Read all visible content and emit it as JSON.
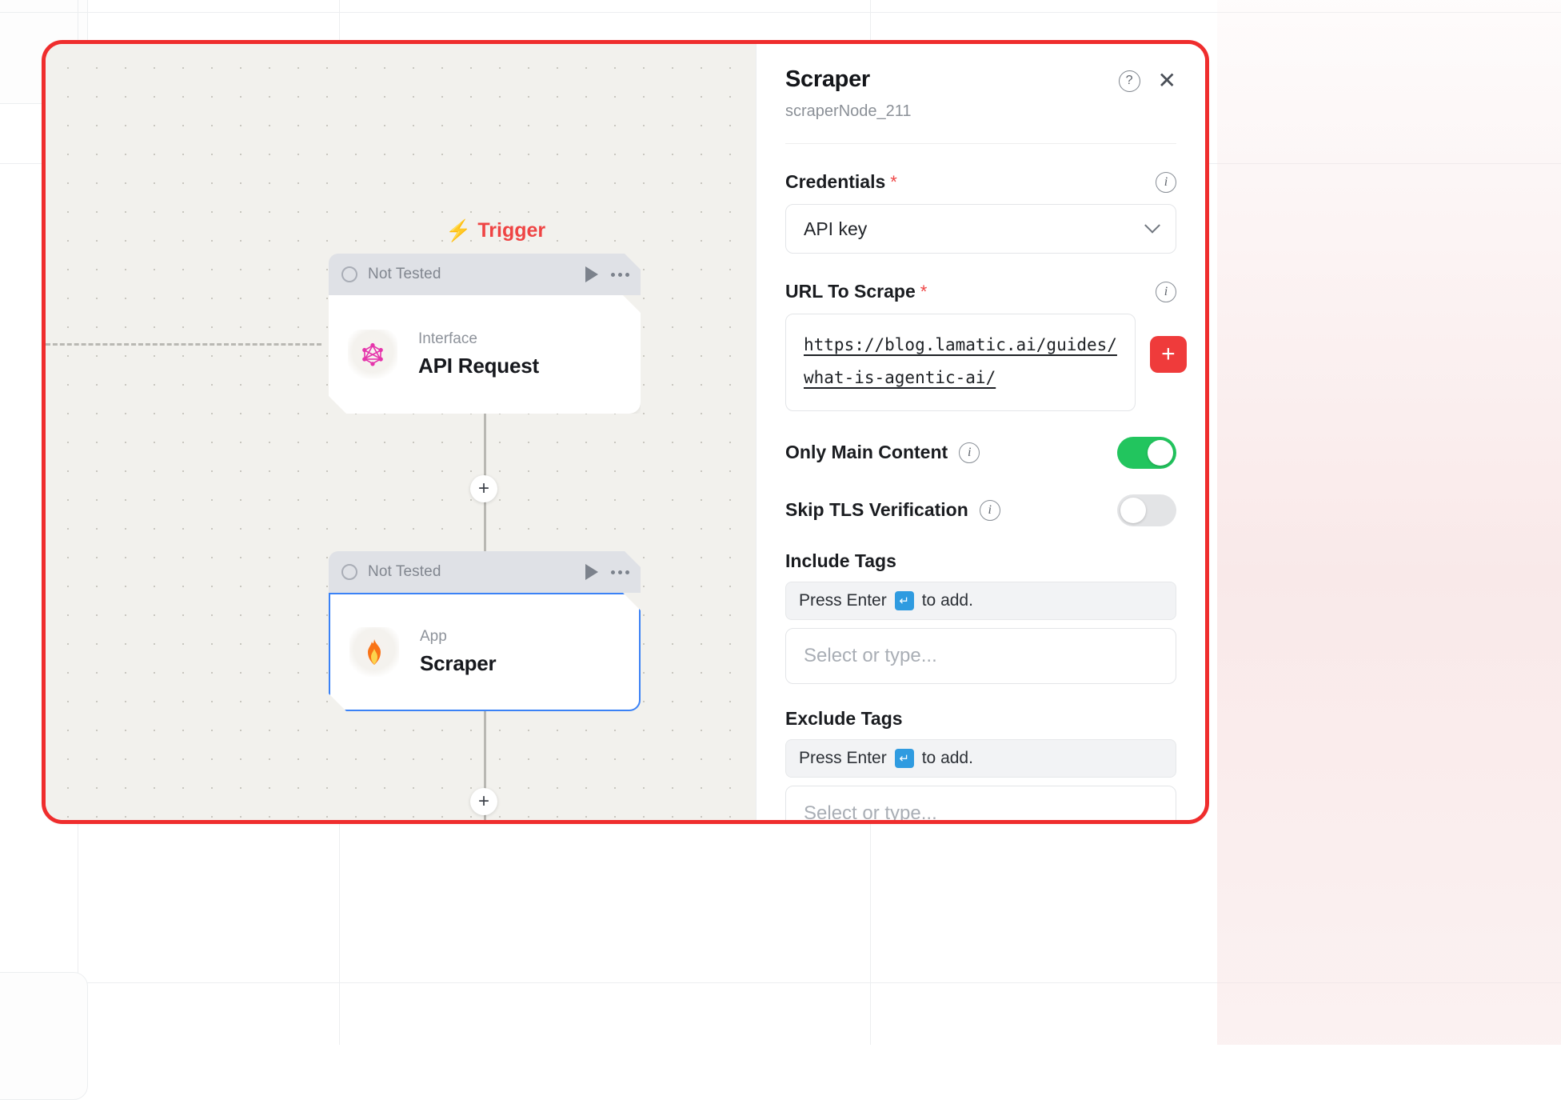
{
  "canvas": {
    "trigger_label": "Trigger",
    "trigger_icon": "lightning-bolt-icon",
    "nodes": [
      {
        "status": "Not Tested",
        "kind": "Interface",
        "title": "API Request",
        "icon": "graphql-icon",
        "glyph": "⬡",
        "selected": false
      },
      {
        "status": "Not Tested",
        "kind": "App",
        "title": "Scraper",
        "icon": "flame-icon",
        "glyph": "🔥",
        "selected": true
      }
    ],
    "add_node_symbol": "+"
  },
  "panel": {
    "title": "Scraper",
    "node_id": "scraperNode_211",
    "help_icon": "question-mark-circle-icon",
    "close_icon": "close-icon",
    "credentials": {
      "label": "Credentials",
      "required_marker": "*",
      "value": "API key",
      "info_icon": "info-icon",
      "chevron_icon": "chevron-down-icon"
    },
    "url_to_scrape": {
      "label": "URL To Scrape",
      "required_marker": "*",
      "value_line1": "https://blog.lamatic.ai/guides/",
      "value_line2": "what-is-agentic-ai/",
      "add_button": "+",
      "info_icon": "info-icon"
    },
    "only_main_content": {
      "label": "Only Main Content",
      "state": "on",
      "info_icon": "info-icon"
    },
    "skip_tls_verification": {
      "label": "Skip TLS Verification",
      "state": "off",
      "info_icon": "info-icon"
    },
    "include_tags": {
      "label": "Include Tags",
      "hint_prefix": "Press Enter",
      "hint_key": "↵",
      "hint_suffix": "to add.",
      "placeholder": "Select or type..."
    },
    "exclude_tags": {
      "label": "Exclude Tags",
      "hint_prefix": "Press Enter",
      "hint_key": "↵",
      "hint_suffix": "to add.",
      "placeholder": "Select or type..."
    }
  },
  "colors": {
    "highlight_border": "#ef2d2d",
    "toggle_on": "#22c55e",
    "accent_red": "#ef3b3b",
    "selection_blue": "#3b82f6",
    "canvas_bg": "#f2f1ed"
  }
}
